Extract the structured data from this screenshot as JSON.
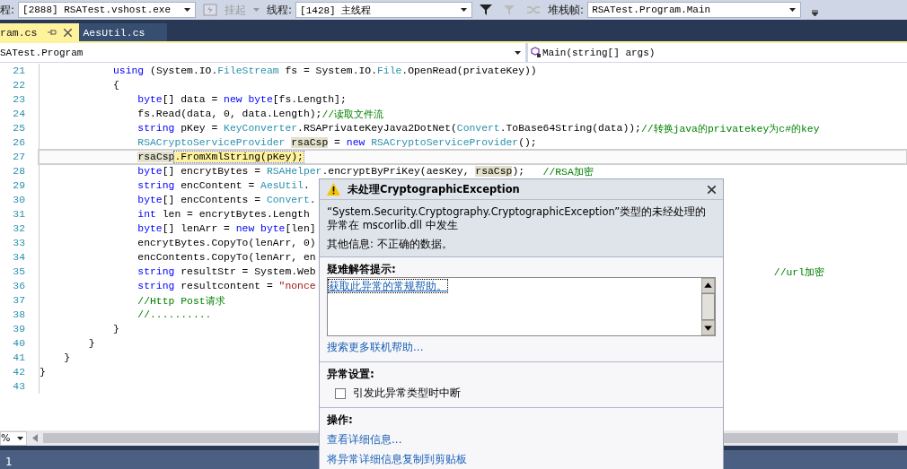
{
  "toolbar": {
    "process_label": "程:",
    "process": "[2888] RSATest.vshost.exe",
    "suspend": {
      "label": "挂起",
      "disabled": true
    },
    "thread_label": "线程:",
    "thread": "[1428] 主线程",
    "stack_label": "堆栈帧:",
    "stack_frame": "RSATest.Program.Main"
  },
  "tabs": [
    {
      "label": "ram.cs",
      "selected": true
    },
    {
      "label": "AesUtil.cs",
      "selected": false
    }
  ],
  "nav": {
    "type_selector": "SATest.Program",
    "member_selector": "Main(string[] args)"
  },
  "code_lines": [
    {
      "number": "21",
      "current": false,
      "tokens": [
        {
          "kind": "keyword",
          "text": "            using"
        },
        {
          "kind": "plain",
          "text": " (System.IO."
        },
        {
          "kind": "type",
          "text": "FileStream"
        },
        {
          "kind": "plain",
          "text": " fs = System.IO."
        },
        {
          "kind": "type",
          "text": "File"
        },
        {
          "kind": "plain",
          "text": ".OpenRead(privateKey))"
        }
      ]
    },
    {
      "number": "22",
      "current": false,
      "tokens": [
        {
          "kind": "plain",
          "text": "            {"
        }
      ]
    },
    {
      "number": "23",
      "current": false,
      "tokens": [
        {
          "kind": "keyword",
          "text": "                byte"
        },
        {
          "kind": "plain",
          "text": "[] data = "
        },
        {
          "kind": "keyword",
          "text": "new byte"
        },
        {
          "kind": "plain",
          "text": "[fs.Length];"
        }
      ]
    },
    {
      "number": "24",
      "current": false,
      "tokens": [
        {
          "kind": "plain",
          "text": "                fs.Read(data, 0, data.Length);"
        },
        {
          "kind": "comment",
          "text": "//读取文件流"
        }
      ]
    },
    {
      "number": "25",
      "current": false,
      "tokens": [
        {
          "kind": "keyword",
          "text": "                string"
        },
        {
          "kind": "plain",
          "text": " pKey = "
        },
        {
          "kind": "type",
          "text": "KeyConverter"
        },
        {
          "kind": "plain",
          "text": ".RSAPrivateKeyJava2DotNet("
        },
        {
          "kind": "type",
          "text": "Convert"
        },
        {
          "kind": "plain",
          "text": ".ToBase64String(data));"
        },
        {
          "kind": "comment",
          "text": "//转换java的privatekey为c#的key"
        }
      ]
    },
    {
      "number": "26",
      "current": false,
      "tokens": [
        {
          "kind": "type",
          "text": "                RSACryptoServiceProvider "
        },
        {
          "kind": "reference",
          "text": "rsaCsp"
        },
        {
          "kind": "plain",
          "text": " = "
        },
        {
          "kind": "keyword",
          "text": "new "
        },
        {
          "kind": "type",
          "text": "RSACryptoServiceProvider"
        },
        {
          "kind": "plain",
          "text": "();"
        }
      ]
    },
    {
      "number": "27",
      "current": true,
      "tokens": [
        {
          "kind": "reference",
          "text": "                rsaCsp"
        },
        {
          "kind": "statement",
          "text": ".FromXmlString(pKey);"
        }
      ]
    },
    {
      "number": "28",
      "current": false,
      "tokens": [
        {
          "kind": "keyword",
          "text": "                byte"
        },
        {
          "kind": "plain",
          "text": "[] encrytBytes = "
        },
        {
          "kind": "type",
          "text": "RSAHelper"
        },
        {
          "kind": "plain",
          "text": ".encryptByPriKey(aesKey, "
        },
        {
          "kind": "reference",
          "text": "rsaCsp"
        },
        {
          "kind": "plain",
          "text": ");   "
        },
        {
          "kind": "comment",
          "text": "//RSA加密"
        }
      ]
    },
    {
      "number": "29",
      "current": false,
      "tokens": [
        {
          "kind": "keyword",
          "text": "                string"
        },
        {
          "kind": "plain",
          "text": " encContent = "
        },
        {
          "kind": "type",
          "text": "AesUtil"
        },
        {
          "kind": "plain",
          "text": "."
        }
      ]
    },
    {
      "number": "30",
      "current": false,
      "tokens": [
        {
          "kind": "keyword",
          "text": "                byte"
        },
        {
          "kind": "plain",
          "text": "[] encContents = "
        },
        {
          "kind": "type",
          "text": "Convert"
        },
        {
          "kind": "plain",
          "text": "."
        }
      ]
    },
    {
      "number": "31",
      "current": false,
      "tokens": [
        {
          "kind": "keyword",
          "text": "                int"
        },
        {
          "kind": "plain",
          "text": " len = encrytBytes.Length"
        }
      ]
    },
    {
      "number": "32",
      "current": false,
      "tokens": [
        {
          "kind": "keyword",
          "text": "                byte"
        },
        {
          "kind": "plain",
          "text": "[] lenArr = "
        },
        {
          "kind": "keyword",
          "text": "new byte"
        },
        {
          "kind": "plain",
          "text": "[len]"
        }
      ]
    },
    {
      "number": "33",
      "current": false,
      "tokens": [
        {
          "kind": "plain",
          "text": "                encrytBytes.CopyTo(lenArr, 0)"
        }
      ]
    },
    {
      "number": "34",
      "current": false,
      "tokens": [
        {
          "kind": "plain",
          "text": "                encContents.CopyTo(lenArr, en"
        }
      ]
    },
    {
      "number": "35",
      "current": false,
      "tokens": [
        {
          "kind": "keyword",
          "text": "                string"
        },
        {
          "kind": "plain",
          "text": " resultStr = System.Web"
        }
      ],
      "trailing_comment": "//url加密"
    },
    {
      "number": "36",
      "current": false,
      "tokens": [
        {
          "kind": "keyword",
          "text": "                string"
        },
        {
          "kind": "plain",
          "text": " resultcontent = "
        },
        {
          "kind": "string",
          "text": "\"nonce"
        }
      ]
    },
    {
      "number": "37",
      "current": false,
      "tokens": [
        {
          "kind": "comment",
          "text": "                //Http Post请求"
        }
      ]
    },
    {
      "number": "38",
      "current": false,
      "tokens": [
        {
          "kind": "comment",
          "text": "                //.........."
        }
      ]
    },
    {
      "number": "39",
      "current": false,
      "tokens": [
        {
          "kind": "plain",
          "text": "            }"
        }
      ]
    },
    {
      "number": "40",
      "current": false,
      "tokens": [
        {
          "kind": "plain",
          "text": "        }"
        }
      ]
    },
    {
      "number": "41",
      "current": false,
      "tokens": [
        {
          "kind": "plain",
          "text": "    }"
        }
      ]
    },
    {
      "number": "42",
      "current": false,
      "tokens": [
        {
          "kind": "plain",
          "text": "}"
        }
      ]
    },
    {
      "number": "43",
      "current": false
    }
  ],
  "zoom_level": "%",
  "status_bar": {
    "text": "1"
  },
  "exception_popup": {
    "title": "未处理CryptographicException",
    "message": "“System.Security.Cryptography.CryptographicException”类型的未经处理的异常在 mscorlib.dll 中发生",
    "additional_info": "其他信息: 不正确的数据。",
    "tips_heading": "疑难解答提示:",
    "tips": [
      {
        "text": "获取此异常的常规帮助。",
        "selected": true
      }
    ],
    "search_link": "搜索更多联机帮助...",
    "settings_heading": "异常设置:",
    "break_checkbox": {
      "label": "引发此异常类型时中断",
      "checked": false
    },
    "actions_heading": "操作:",
    "actions": [
      "查看详细信息...",
      "将异常详细信息复制到剪贴板"
    ]
  }
}
